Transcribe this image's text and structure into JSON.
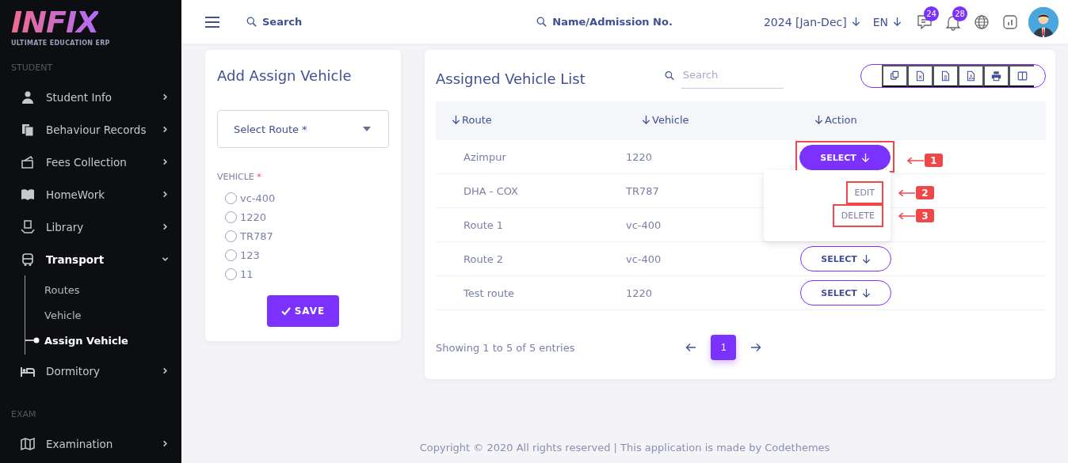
{
  "logo": {
    "wordmark": "INFIX",
    "tagline": "ULTIMATE EDUCATION ERP"
  },
  "sidebar": {
    "sections": [
      {
        "heading": "STUDENT",
        "items": [
          {
            "label": "Student Info",
            "expanded": false
          },
          {
            "label": "Behaviour Records",
            "expanded": false
          },
          {
            "label": "Fees Collection",
            "expanded": false
          },
          {
            "label": "HomeWork",
            "expanded": false
          },
          {
            "label": "Library",
            "expanded": false
          },
          {
            "label": "Transport",
            "expanded": true,
            "children": [
              {
                "label": "Routes",
                "selected": false
              },
              {
                "label": "Vehicle",
                "selected": false
              },
              {
                "label": "Assign Vehicle",
                "selected": true
              }
            ]
          },
          {
            "label": "Dormitory",
            "expanded": false
          }
        ]
      },
      {
        "heading": "EXAM",
        "items": [
          {
            "label": "Examination",
            "expanded": false
          }
        ]
      }
    ]
  },
  "header": {
    "search_placeholder": "Search",
    "admission_search": "Name/Admission No.",
    "session": "2024 [Jan-Dec]",
    "language": "EN",
    "messages_badge": "24",
    "notifications_badge": "28"
  },
  "form": {
    "title": "Add Assign Vehicle",
    "route_select": {
      "placeholder": "Select Route *"
    },
    "vehicle_label": "VEHICLE",
    "vehicle_required_mark": "*",
    "vehicles": [
      {
        "label": "vc-400",
        "selected": false
      },
      {
        "label": "1220",
        "selected": false
      },
      {
        "label": "TR787",
        "selected": false
      },
      {
        "label": "123",
        "selected": false
      },
      {
        "label": "11",
        "selected": false
      }
    ],
    "save_button": "SAVE"
  },
  "list": {
    "title": "Assigned Vehicle List",
    "search": {
      "placeholder": "Search"
    },
    "toolbar": [
      {
        "kind": "copy"
      },
      {
        "kind": "excel"
      },
      {
        "kind": "csv"
      },
      {
        "kind": "pdf"
      },
      {
        "kind": "print"
      },
      {
        "kind": "columns"
      }
    ],
    "columns": [
      "Route",
      "Vehicle",
      "Action"
    ],
    "rows": [
      {
        "route": "Azimpur",
        "vehicle": "1220",
        "action": "SELECT",
        "selected": true,
        "callout": "1"
      },
      {
        "route": "DHA - COX",
        "vehicle": "TR787"
      },
      {
        "route": "Route 1",
        "vehicle": "vc-400"
      },
      {
        "route": "Route 2",
        "vehicle": "vc-400",
        "action": "SELECT",
        "selected": false
      },
      {
        "route": "Test route",
        "vehicle": "1220",
        "action": "SELECT",
        "selected": false
      }
    ],
    "action_menu": [
      {
        "label": "EDIT",
        "callout": "2"
      },
      {
        "label": "DELETE",
        "callout": "3"
      }
    ],
    "summary": "Showing 1 to 5 of 5 entries",
    "pages": [
      {
        "label": "1",
        "selected": true
      }
    ]
  },
  "footer": "Copyright © 2020 All rights reserved | This application is made by Codethemes"
}
